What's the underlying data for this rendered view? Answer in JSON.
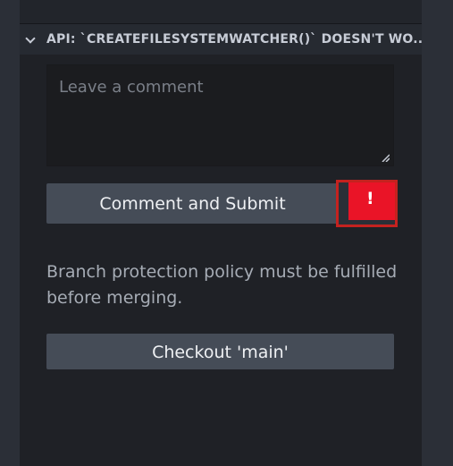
{
  "section": {
    "title": "API: `CREATEFILESYSTEMWATCHER()` DOESN'T WO..."
  },
  "comment": {
    "placeholder": "Leave a comment"
  },
  "actions": {
    "submit_label": "Comment and Submit",
    "alert_label": "!",
    "checkout_label": "Checkout 'main'"
  },
  "status": {
    "policy_message": "Branch protection policy must be fulfilled before merging."
  },
  "icons": {
    "section_toggle": "chevron-down-icon",
    "textarea_resize": "resize-grip-icon"
  },
  "colors": {
    "alert_red": "#ea1427",
    "button": "#454c57"
  }
}
